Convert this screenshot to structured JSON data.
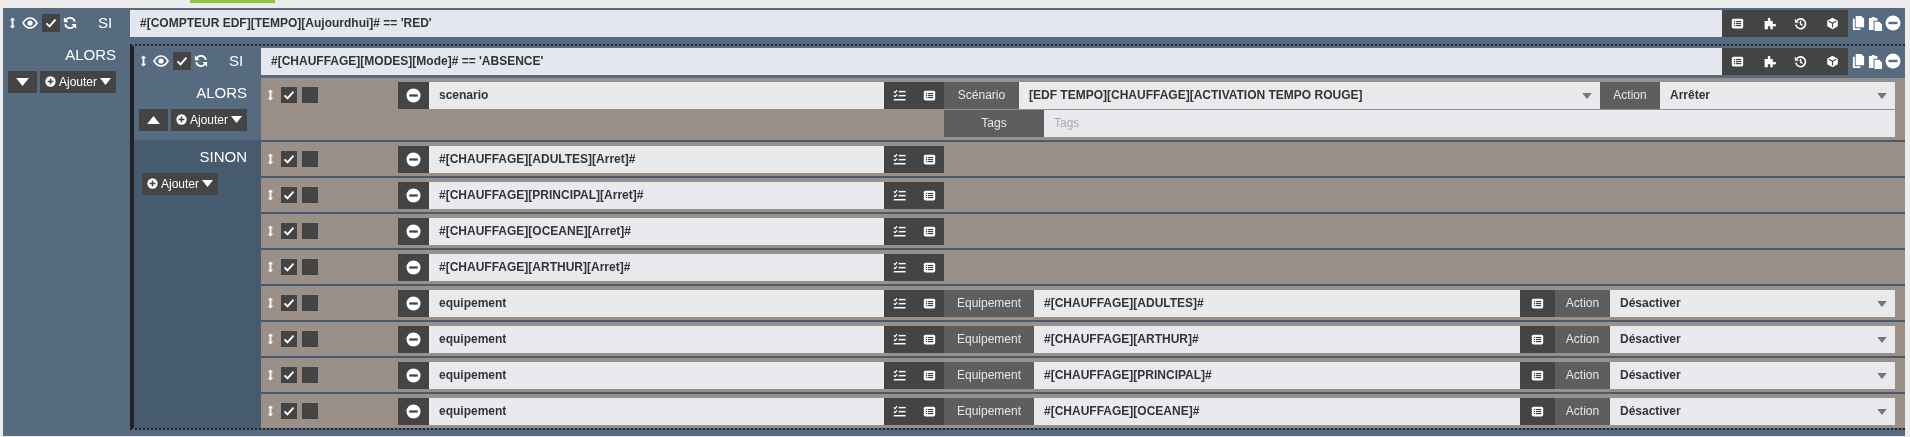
{
  "if_block": {
    "keyword": "SI",
    "enabled": true,
    "condition": "#[COMPTEUR EDF][TEMPO][Aujourdhui]# == 'RED'",
    "then_label": "ALORS",
    "expanded": false,
    "add_label": "Ajouter",
    "nested": {
      "keyword": "SI",
      "enabled": true,
      "condition": "#[CHAUFFAGE][MODES][Mode]# == 'ABSENCE'",
      "then_label": "ALORS",
      "expanded": true,
      "add_label": "Ajouter",
      "then_actions": [
        {
          "kind": "scenario",
          "enabled": true,
          "parallel": false,
          "name": "scenario",
          "target_label": "Scénario",
          "target": "[EDF TEMPO][CHAUFFAGE][ACTIVATION TEMPO ROUGE]",
          "action_label": "Action",
          "action": "Arrêter",
          "tags_label": "Tags",
          "tags_placeholder": "Tags"
        }
      ],
      "else_label": "SINON",
      "else_add_label": "Ajouter",
      "else_actions": [
        {
          "kind": "expression",
          "enabled": true,
          "parallel": false,
          "name": "#[CHAUFFAGE][ADULTES][Arret]#"
        },
        {
          "kind": "expression",
          "enabled": true,
          "parallel": false,
          "name": "#[CHAUFFAGE][PRINCIPAL][Arret]#"
        },
        {
          "kind": "expression",
          "enabled": true,
          "parallel": false,
          "name": "#[CHAUFFAGE][OCEANE][Arret]#"
        },
        {
          "kind": "expression",
          "enabled": true,
          "parallel": false,
          "name": "#[CHAUFFAGE][ARTHUR][Arret]#"
        },
        {
          "kind": "equipment",
          "enabled": true,
          "parallel": false,
          "name": "equipement",
          "target_label": "Equipement",
          "target": "#[CHAUFFAGE][ADULTES]#",
          "action_label": "Action",
          "action": "Désactiver"
        },
        {
          "kind": "equipment",
          "enabled": true,
          "parallel": false,
          "name": "equipement",
          "target_label": "Equipement",
          "target": "#[CHAUFFAGE][ARTHUR]#",
          "action_label": "Action",
          "action": "Désactiver"
        },
        {
          "kind": "equipment",
          "enabled": true,
          "parallel": false,
          "name": "equipement",
          "target_label": "Equipement",
          "target": "#[CHAUFFAGE][PRINCIPAL]#",
          "action_label": "Action",
          "action": "Désactiver"
        },
        {
          "kind": "equipment",
          "enabled": true,
          "parallel": false,
          "name": "equipement",
          "target_label": "Equipement",
          "target": "#[CHAUFFAGE][OCEANE]#",
          "action_label": "Action",
          "action": "Désactiver"
        }
      ]
    }
  }
}
